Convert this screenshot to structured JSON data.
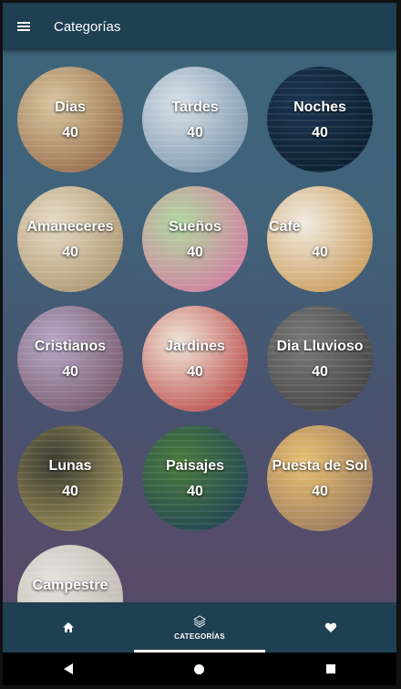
{
  "app_bar": {
    "title": "Categorías"
  },
  "categories": [
    {
      "name": "Dias",
      "count": "40",
      "colors": [
        "#d8c6a0",
        "#8a5a3a"
      ]
    },
    {
      "name": "Tardes",
      "count": "40",
      "colors": [
        "#d8e2ea",
        "#6a86a0"
      ]
    },
    {
      "name": "Noches",
      "count": "40",
      "colors": [
        "#1a3550",
        "#0a1a2a"
      ]
    },
    {
      "name": "Amaneceres",
      "count": "40",
      "colors": [
        "#e8dcc6",
        "#a08860"
      ]
    },
    {
      "name": "Sueños",
      "count": "40",
      "colors": [
        "#b0d8a0",
        "#d86aa0"
      ]
    },
    {
      "name": "Cafe",
      "count": "40",
      "colors": [
        "#f2ebe0",
        "#c08a40"
      ]
    },
    {
      "name": "Cristianos",
      "count": "40",
      "colors": [
        "#b8a8c8",
        "#6a4a5a"
      ]
    },
    {
      "name": "Jardines",
      "count": "40",
      "colors": [
        "#f0e6d8",
        "#b03030"
      ]
    },
    {
      "name": "Dia Lluvioso",
      "count": "40",
      "colors": [
        "#7a7a7a",
        "#3a3a3a"
      ]
    },
    {
      "name": "Lunas",
      "count": "40",
      "colors": [
        "#3a3a30",
        "#b0a060"
      ]
    },
    {
      "name": "Paisajes",
      "count": "40",
      "colors": [
        "#4a7a3a",
        "#1a3a5a"
      ]
    },
    {
      "name": "Puesta de Sol",
      "count": "40",
      "colors": [
        "#e8c070",
        "#8a6a5a"
      ]
    },
    {
      "name": "Campestre",
      "count": "",
      "colors": [
        "#e6e2dc",
        "#b8b0a8"
      ]
    }
  ],
  "bottom_nav": {
    "items": [
      {
        "icon": "home-icon",
        "label": ""
      },
      {
        "icon": "layers-icon",
        "label": "CATEGORÍAS"
      },
      {
        "icon": "heart-icon",
        "label": ""
      }
    ],
    "selected": 1
  },
  "colors": {
    "app_bar": "#1f3f52",
    "text": "#ffffff"
  }
}
